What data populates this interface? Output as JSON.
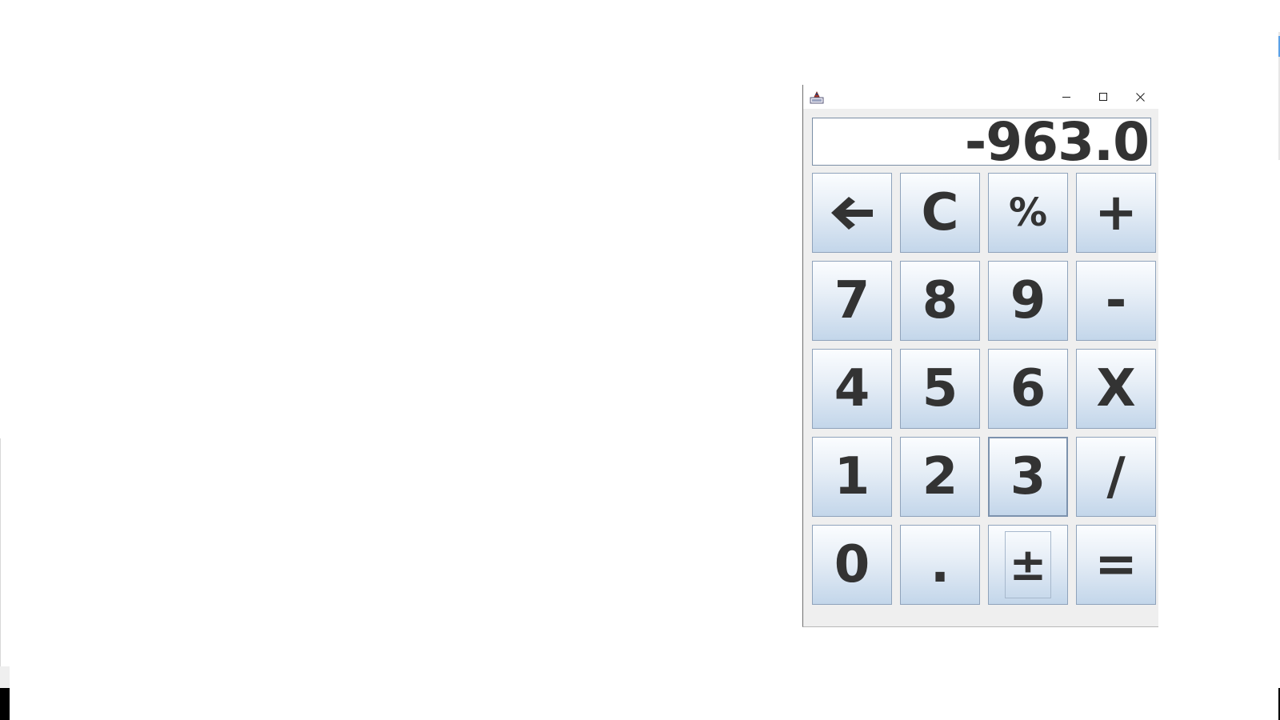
{
  "window": {
    "title": ""
  },
  "display": {
    "value": "-963.0"
  },
  "keys": [
    {
      "label": "←",
      "icon": "backspace-arrow-icon"
    },
    {
      "label": "C"
    },
    {
      "label": "%"
    },
    {
      "label": "+"
    },
    {
      "label": "7"
    },
    {
      "label": "8"
    },
    {
      "label": "9"
    },
    {
      "label": "-"
    },
    {
      "label": "4"
    },
    {
      "label": "5"
    },
    {
      "label": "6"
    },
    {
      "label": "X"
    },
    {
      "label": "1"
    },
    {
      "label": "2"
    },
    {
      "label": "3"
    },
    {
      "label": "/"
    },
    {
      "label": "0"
    },
    {
      "label": "."
    },
    {
      "label": "±"
    },
    {
      "label": "="
    }
  ],
  "colors": {
    "key_top": "#fbfdff",
    "key_bottom": "#c3d6ea",
    "key_border": "#8fa3bb",
    "text": "#333333"
  }
}
